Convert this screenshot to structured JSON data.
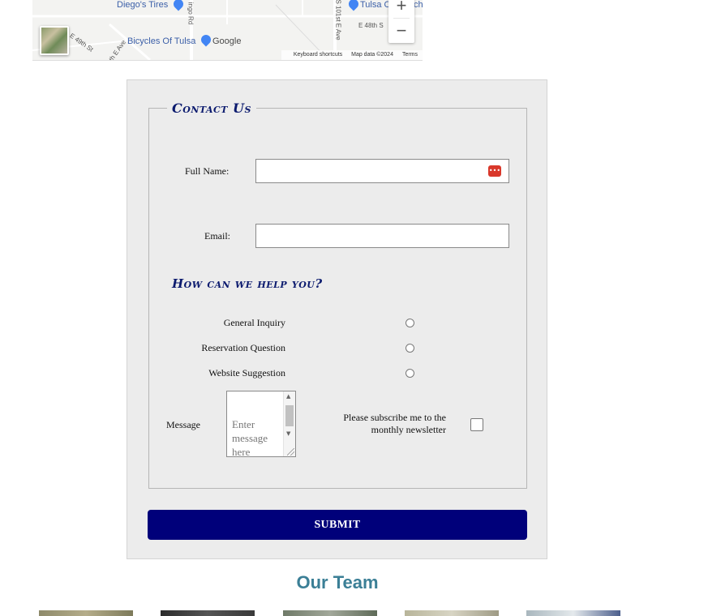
{
  "map": {
    "labels": {
      "diegos_tires": "Diego's Tires",
      "tulsa_poi": "Tulsa C",
      "tulsa_poi_suffix": "ch",
      "bicycles_of_tulsa": "Bicycles Of Tulsa",
      "e48th": "E 48th S",
      "e49th": "E 49th St",
      "s101st": "S 101st E Ave",
      "ingo_rd": "ingo Rd",
      "th_e_ave": "th E Ave"
    },
    "google_logo": "Google",
    "zoom_in": "+",
    "zoom_out": "−",
    "attribution": {
      "shortcuts": "Keyboard shortcuts",
      "map_data": "Map data ©2024",
      "terms": "Terms"
    }
  },
  "form": {
    "legend": "Contact Us",
    "full_name_label": "Full Name:",
    "full_name_value": "",
    "email_label": "Email:",
    "email_value": "",
    "help_heading": "How can we help you?",
    "options": [
      {
        "label": "General Inquiry",
        "selected": false
      },
      {
        "label": "Reservation Question",
        "selected": false
      },
      {
        "label": "Website Suggestion",
        "selected": false
      }
    ],
    "message_label": "Message",
    "message_placeholder": "Enter message here",
    "subscribe_label": "Please subscribe me to the monthly newsletter",
    "subscribe_checked": false,
    "submit_label": "SUBMIT",
    "password_manager_icon": "password-manager-icon"
  },
  "team": {
    "title": "Our Team"
  },
  "colors": {
    "accent": "#00007a",
    "heading": "#0b1a6e",
    "team_title": "#3b7f96",
    "panel_bg": "#ececec"
  }
}
